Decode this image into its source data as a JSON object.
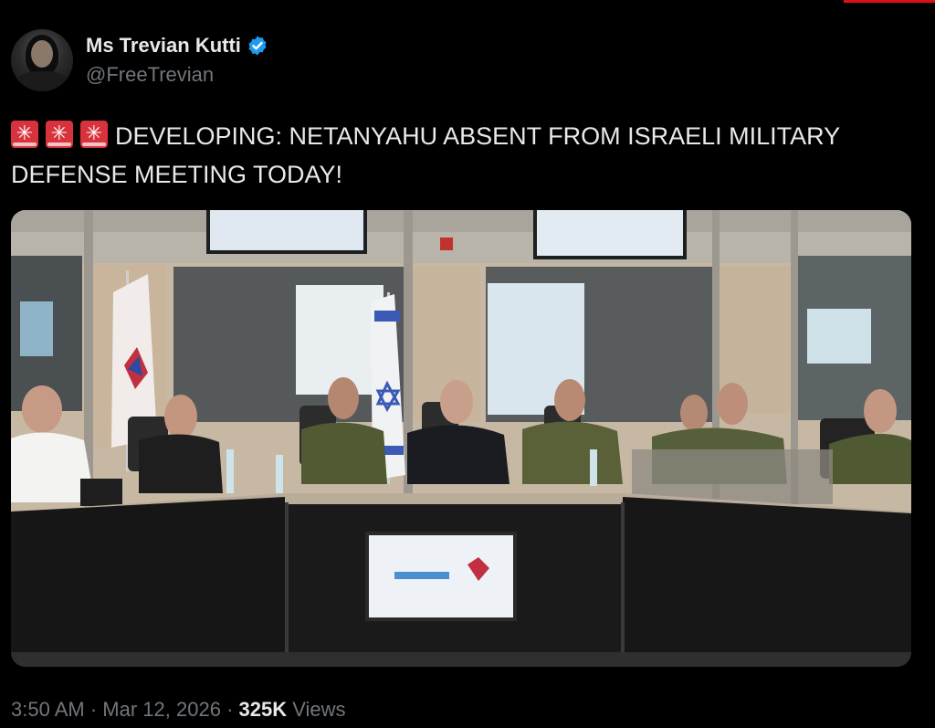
{
  "author": {
    "display_name": "Ms Trevian Kutti",
    "handle": "@FreeTrevian",
    "verified": true,
    "verified_color": "#1d9bf0"
  },
  "tweet": {
    "emoji": [
      "rotating-light",
      "rotating-light",
      "rotating-light"
    ],
    "text": "DEVELOPING: NETANYAHU ABSENT FROM ISRAELI MILITARY DEFENSE MEETING TODAY!"
  },
  "footer": {
    "time": "3:50 AM",
    "date": "Mar 12, 2026",
    "views_count": "325K",
    "views_label": "Views",
    "separator": "·"
  },
  "colors": {
    "background": "#000000",
    "text": "#e7e9ea",
    "secondary": "#71767b"
  }
}
